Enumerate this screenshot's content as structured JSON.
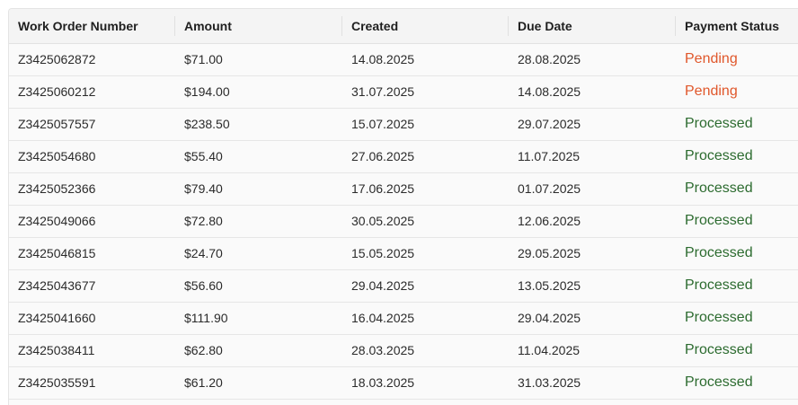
{
  "table": {
    "headers": [
      "Work Order Number",
      "Amount",
      "Created",
      "Due Date",
      "Payment Status"
    ],
    "rows": [
      {
        "work_order": "Z3425062872",
        "amount": "$71.00",
        "created": "14.08.2025",
        "due": "28.08.2025",
        "status": "Pending",
        "status_color": "#e0572b"
      },
      {
        "work_order": "Z3425060212",
        "amount": "$194.00",
        "created": "31.07.2025",
        "due": "14.08.2025",
        "status": "Pending",
        "status_color": "#e0572b"
      },
      {
        "work_order": "Z3425057557",
        "amount": "$238.50",
        "created": "15.07.2025",
        "due": "29.07.2025",
        "status": "Processed",
        "status_color": "#2c6b2f"
      },
      {
        "work_order": "Z3425054680",
        "amount": "$55.40",
        "created": "27.06.2025",
        "due": "11.07.2025",
        "status": "Processed",
        "status_color": "#2c6b2f"
      },
      {
        "work_order": "Z3425052366",
        "amount": "$79.40",
        "created": "17.06.2025",
        "due": "01.07.2025",
        "status": "Processed",
        "status_color": "#2c6b2f"
      },
      {
        "work_order": "Z3425049066",
        "amount": "$72.80",
        "created": "30.05.2025",
        "due": "12.06.2025",
        "status": "Processed",
        "status_color": "#2c6b2f"
      },
      {
        "work_order": "Z3425046815",
        "amount": "$24.70",
        "created": "15.05.2025",
        "due": "29.05.2025",
        "status": "Processed",
        "status_color": "#2c6b2f"
      },
      {
        "work_order": "Z3425043677",
        "amount": "$56.60",
        "created": "29.04.2025",
        "due": "13.05.2025",
        "status": "Processed",
        "status_color": "#2c6b2f"
      },
      {
        "work_order": "Z3425041660",
        "amount": "$111.90",
        "created": "16.04.2025",
        "due": "29.04.2025",
        "status": "Processed",
        "status_color": "#2c6b2f"
      },
      {
        "work_order": "Z3425038411",
        "amount": "$62.80",
        "created": "28.03.2025",
        "due": "11.04.2025",
        "status": "Processed",
        "status_color": "#2c6b2f"
      },
      {
        "work_order": "Z3425035591",
        "amount": "$61.20",
        "created": "18.03.2025",
        "due": "31.03.2025",
        "status": "Processed",
        "status_color": "#2c6b2f"
      }
    ]
  }
}
